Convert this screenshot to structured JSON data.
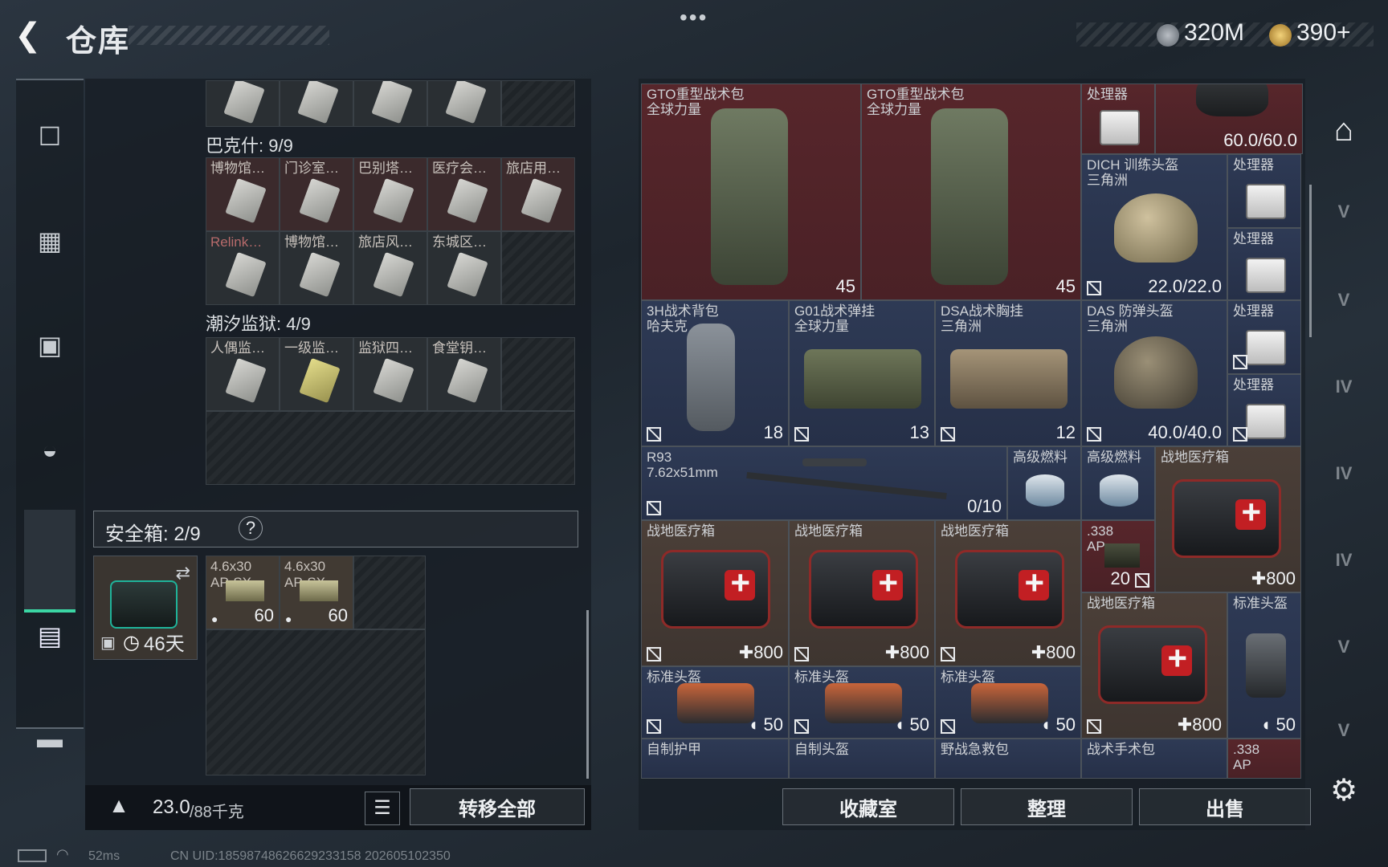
{
  "header": {
    "title": "仓库",
    "menu": "•••",
    "currency_1": "320M",
    "currency_2": "390+"
  },
  "left": {
    "section_1": "巴克什: 9/9",
    "section_1_items": [
      "博物馆…",
      "门诊室…",
      "巴别塔…",
      "医疗会…",
      "旅店用…",
      "Relink…",
      "博物馆…",
      "旅店风…",
      "东城区…"
    ],
    "section_2": "潮汐监狱: 4/9",
    "section_2_items": [
      "人偶监…",
      "一级监…",
      "监狱四…",
      "食堂钥…"
    ],
    "safebox_label": "安全箱: 2/9",
    "safebox_help": "?",
    "safebox_days": "46天",
    "ammo_1_name": "4.6x30\nAP-SX",
    "ammo_1_count": "60",
    "ammo_2_name": "4.6x30\nAP-SX",
    "ammo_2_count": "60",
    "weight_current": "23.0",
    "weight_max": "/88千克",
    "transfer_all": "转移全部"
  },
  "right": {
    "items": {
      "gto1_name": "GTO重型战术包\n全球力量",
      "gto1_val": "45",
      "gto2_name": "GTO重型战术包\n全球力量",
      "gto2_val": "45",
      "proc1": "处理器",
      "helmet_top_val": "60.0/60.0",
      "dich_name": "DICH 训练头盔\n三角洲",
      "dich_val": "22.0/22.0",
      "proc2": "处理器",
      "proc3": "处理器",
      "bag3h_name": "3H战术背包\n哈夫克",
      "bag3h_val": "18",
      "g01_name": "G01战术弹挂\n全球力量",
      "g01_val": "13",
      "dsa_name": "DSA战术胸挂\n三角洲",
      "dsa_val": "12",
      "das_name": "DAS 防弹头盔\n三角洲",
      "das_val": "40.0/40.0",
      "proc4": "处理器",
      "proc5": "处理器",
      "r93_name": "R93\n7.62x51mm",
      "r93_val": "0/10",
      "fuel1": "高级燃料",
      "fuel2": "高级燃料",
      "med_big": "战地医疗箱",
      "med_big_val": "800",
      "med1": "战地医疗箱",
      "med1_val": "800",
      "med2": "战地医疗箱",
      "med2_val": "800",
      "med3": "战地医疗箱",
      "med3_val": "800",
      "ap338_name": ".338\nAP",
      "ap338_val": "20",
      "med4": "战地医疗箱",
      "med4_val": "800",
      "std_helm": "标准头盔",
      "std_helm_val": "50",
      "sb1": "标准头盔",
      "sb1_val": "50",
      "sb2": "标准头盔",
      "sb2_val": "50",
      "sb3": "标准头盔",
      "sb3_val": "50",
      "b1": "自制护甲",
      "b2": "自制头盔",
      "b3": "野战急救包",
      "b4": "战术手术包",
      "b5": ".338\nAP"
    },
    "buttons": {
      "collection": "收藏室",
      "sort": "整理",
      "sell": "出售"
    }
  },
  "side_tabs": [
    "V",
    "V",
    "IV",
    "IV",
    "IV",
    "V",
    "V"
  ],
  "status": {
    "ping": "52ms",
    "uid": "CN UID:18598748626629233158 202605102350"
  },
  "colors": {
    "accent": "#3bd6a4",
    "rare_red": "#57262b",
    "rare_blue": "#2e3a55",
    "rare_brown": "#4b3f38"
  }
}
